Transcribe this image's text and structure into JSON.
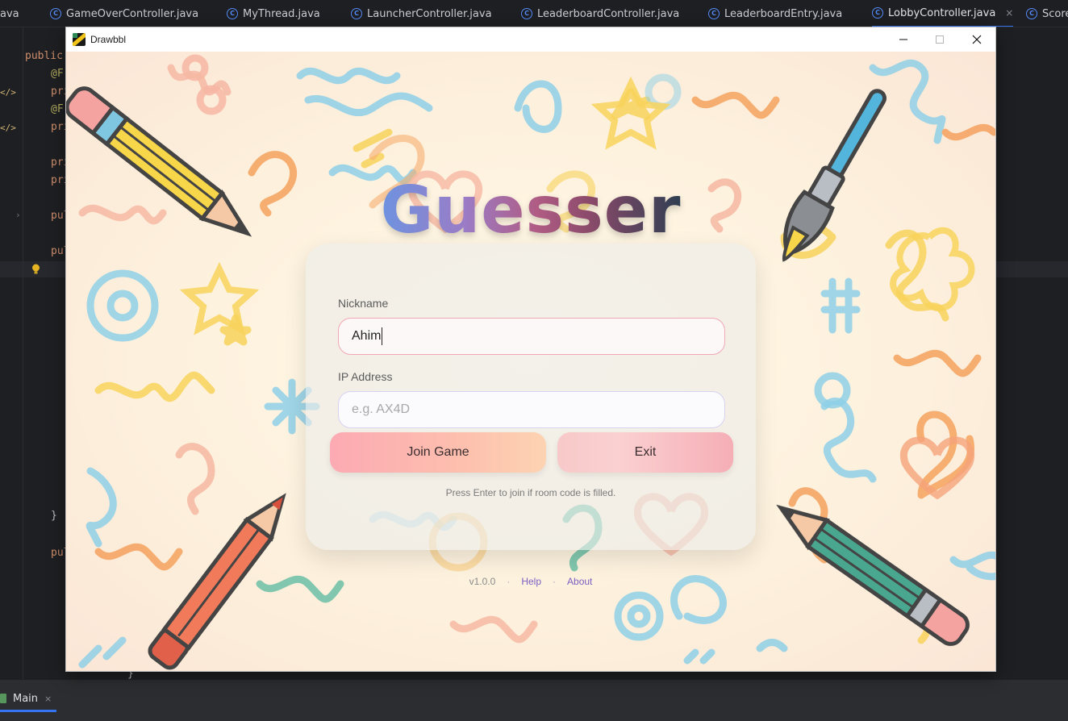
{
  "ide": {
    "tabs": [
      {
        "label": "ava",
        "icon": null,
        "active": false,
        "closable": false
      },
      {
        "label": "GameOverController.java",
        "icon": "class-icon",
        "active": false,
        "closable": false
      },
      {
        "label": "MyThread.java",
        "icon": "class-icon",
        "active": false,
        "closable": false
      },
      {
        "label": "LauncherController.java",
        "icon": "class-icon",
        "active": false,
        "closable": false
      },
      {
        "label": "LeaderboardController.java",
        "icon": "class-icon",
        "active": false,
        "closable": false
      },
      {
        "label": "LeaderboardEntry.java",
        "icon": "class-icon",
        "active": false,
        "closable": false
      },
      {
        "label": "LobbyController.java",
        "icon": "class-icon",
        "active": true,
        "closable": true
      },
      {
        "label": "Score",
        "icon": "class-icon",
        "active": false,
        "closable": false
      }
    ],
    "close_glyph": "×",
    "code": {
      "public": "public",
      "annotation_1": "@F:",
      "annotation_2": "@F:",
      "pri_1": "pri",
      "pri_2": "pri",
      "pri_3": "pri",
      "pri_4": "pri",
      "pul_1": "pul",
      "pul_2": "pul",
      "pul_3": "pul",
      "brace": "}",
      "brace_2": "}",
      "tag_1": "</>",
      "tag_2": "</>"
    },
    "run_tab": {
      "label": "Main",
      "close": "×"
    },
    "accent": "#3574f0"
  },
  "window": {
    "title": "Drawbbl",
    "controls": [
      "minimize",
      "maximize",
      "close"
    ]
  },
  "app": {
    "logo": "Guesser",
    "nickname": {
      "label": "Nickname",
      "value": "Ahim"
    },
    "ip": {
      "label": "IP Address",
      "placeholder": "e.g. AX4D"
    },
    "join_button": "Join Game",
    "exit_button": "Exit",
    "hint": "Press Enter to join if room code is filled.",
    "footer": {
      "version": "v1.0.0",
      "separator": "·",
      "help": "Help",
      "about": "About"
    },
    "colors": {
      "join_gradient": [
        "#fcaab3",
        "#fdd3b2"
      ],
      "exit_gradient": [
        "#f7c9c9",
        "#f5aeb6"
      ],
      "link": "#7a5ec2",
      "nickname_border": "#f2a7b4"
    }
  }
}
